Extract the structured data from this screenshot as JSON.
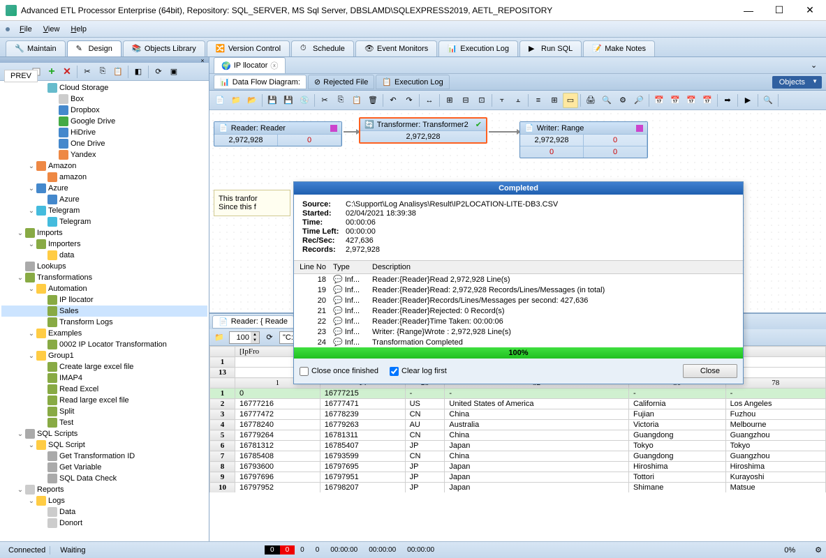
{
  "titlebar": {
    "title": "Advanced ETL Processor Enterprise (64bit), Repository: SQL_SERVER, MS Sql Server, DBSLAMD\\SQLEXPRESS2019, AETL_REPOSITORY"
  },
  "menubar": [
    "File",
    "View",
    "Help"
  ],
  "maintabs": [
    "Maintain",
    "Design",
    "Objects Library",
    "Version Control",
    "Schedule",
    "Event Monitors",
    "Execution Log",
    "Run SQL",
    "Make Notes"
  ],
  "maintabs_active": 1,
  "prev_btn": "PREV",
  "tree": [
    {
      "d": 3,
      "exp": "",
      "icon": "#6bc",
      "label": "Cloud Storage"
    },
    {
      "d": 4,
      "exp": "",
      "icon": "#ccc",
      "label": "Box"
    },
    {
      "d": 4,
      "exp": "",
      "icon": "#48c",
      "label": "Dropbox"
    },
    {
      "d": 4,
      "exp": "",
      "icon": "#4a4",
      "label": "Google Drive"
    },
    {
      "d": 4,
      "exp": "",
      "icon": "#48c",
      "label": "HiDrive"
    },
    {
      "d": 4,
      "exp": "",
      "icon": "#48c",
      "label": "One Drive"
    },
    {
      "d": 4,
      "exp": "",
      "icon": "#e84",
      "label": "Yandex"
    },
    {
      "d": 2,
      "exp": "v",
      "icon": "#e84",
      "label": "Amazon"
    },
    {
      "d": 3,
      "exp": "",
      "icon": "#e84",
      "label": "amazon"
    },
    {
      "d": 2,
      "exp": "v",
      "icon": "#48c",
      "label": "Azure"
    },
    {
      "d": 3,
      "exp": "",
      "icon": "#48c",
      "label": "Azure"
    },
    {
      "d": 2,
      "exp": "v",
      "icon": "#4bd",
      "label": "Telegram"
    },
    {
      "d": 3,
      "exp": "",
      "icon": "#4bd",
      "label": "Telegram"
    },
    {
      "d": 1,
      "exp": "v",
      "icon": "#8a4",
      "label": "Imports"
    },
    {
      "d": 2,
      "exp": "v",
      "icon": "#8a4",
      "label": "Importers"
    },
    {
      "d": 3,
      "exp": "",
      "icon": "#fc4",
      "label": "data"
    },
    {
      "d": 1,
      "exp": "",
      "icon": "#aaa",
      "label": "Lookups"
    },
    {
      "d": 1,
      "exp": "v",
      "icon": "#8a4",
      "label": "Transformations"
    },
    {
      "d": 2,
      "exp": "v",
      "icon": "#fc4",
      "label": "Automation"
    },
    {
      "d": 3,
      "exp": "",
      "icon": "#8a4",
      "label": "IP llocator"
    },
    {
      "d": 3,
      "exp": "",
      "icon": "#8a4",
      "label": "Sales",
      "selected": true
    },
    {
      "d": 3,
      "exp": "",
      "icon": "#8a4",
      "label": "Transform Logs"
    },
    {
      "d": 2,
      "exp": "v",
      "icon": "#fc4",
      "label": "Examples"
    },
    {
      "d": 3,
      "exp": "",
      "icon": "#8a4",
      "label": "0002 IP Locator Transformation"
    },
    {
      "d": 2,
      "exp": "v",
      "icon": "#fc4",
      "label": "Group1"
    },
    {
      "d": 3,
      "exp": "",
      "icon": "#8a4",
      "label": "Create large excel file"
    },
    {
      "d": 3,
      "exp": "",
      "icon": "#8a4",
      "label": "IMAP4"
    },
    {
      "d": 3,
      "exp": "",
      "icon": "#8a4",
      "label": "Read Excel"
    },
    {
      "d": 3,
      "exp": "",
      "icon": "#8a4",
      "label": "Read large excel file"
    },
    {
      "d": 3,
      "exp": "",
      "icon": "#8a4",
      "label": "Split"
    },
    {
      "d": 3,
      "exp": "",
      "icon": "#8a4",
      "label": "Test"
    },
    {
      "d": 1,
      "exp": "v",
      "icon": "#aaa",
      "label": "SQL Scripts"
    },
    {
      "d": 2,
      "exp": "v",
      "icon": "#fc4",
      "label": "SQL Script"
    },
    {
      "d": 3,
      "exp": "",
      "icon": "#aaa",
      "label": "Get Transformation ID"
    },
    {
      "d": 3,
      "exp": "",
      "icon": "#aaa",
      "label": "Get Variable"
    },
    {
      "d": 3,
      "exp": "",
      "icon": "#aaa",
      "label": "SQL Data Check"
    },
    {
      "d": 1,
      "exp": "v",
      "icon": "#ccc",
      "label": "Reports"
    },
    {
      "d": 2,
      "exp": "v",
      "icon": "#fc4",
      "label": "Logs"
    },
    {
      "d": 3,
      "exp": "",
      "icon": "#ccc",
      "label": "Data"
    },
    {
      "d": 3,
      "exp": "",
      "icon": "#ccc",
      "label": "Donort"
    }
  ],
  "doc_tab": {
    "label": "IP llocator"
  },
  "subtabs": [
    "Data Flow Diagram:",
    "Rejected File",
    "Execution Log"
  ],
  "subtabs_active": 0,
  "objects_label": "Objects",
  "nodes": {
    "reader": {
      "title": "Reader: Reader",
      "records": "2,972,928",
      "rejected": "0"
    },
    "transformer": {
      "title": "Transformer: Transformer2",
      "records": "2,972,928"
    },
    "writer": {
      "title": "Writer: Range",
      "records": "2,972,928",
      "rejected": "0",
      "r2a": "0",
      "r2b": "0"
    }
  },
  "note": {
    "l1": "This tranfor",
    "l2": "Since this f"
  },
  "completed": {
    "title": "Completed",
    "info": [
      {
        "k": "Source:",
        "v": "C:\\Support\\Log Analisys\\Result\\IP2LOCATION-LITE-DB3.CSV"
      },
      {
        "k": "Started:",
        "v": "02/04/2021 18:39:38"
      },
      {
        "k": "Time:",
        "v": "00:00:06"
      },
      {
        "k": "Time Left:",
        "v": "00:00:00"
      },
      {
        "k": "Rec/Sec:",
        "v": "427,636"
      },
      {
        "k": "Records:",
        "v": "2,972,928"
      }
    ],
    "log_headers": [
      "Line No",
      "Type",
      "Description"
    ],
    "log": [
      {
        "n": "18",
        "t": "Inf...",
        "d": "Reader:{Reader}Read 2,972,928 Line(s)"
      },
      {
        "n": "19",
        "t": "Inf...",
        "d": "Reader:{Reader}Read: 2,972,928 Records/Lines/Messages (in total)"
      },
      {
        "n": "20",
        "t": "Inf...",
        "d": "Reader:{Reader}Records/Lines/Messages per second: 427,636"
      },
      {
        "n": "21",
        "t": "Inf...",
        "d": "Reader:{Reader}Rejected: 0 Record(s)"
      },
      {
        "n": "22",
        "t": "Inf...",
        "d": "Reader:{Reader}Time Taken: 00:00:06"
      },
      {
        "n": "23",
        "t": "Inf...",
        "d": "Writer: {Range}Wrote : 2,972,928 Line(s)"
      },
      {
        "n": "24",
        "t": "Inf...",
        "d": "Transformation Completed"
      }
    ],
    "progress": "100%",
    "close_once": "Close once finished",
    "clear_log": "Clear log first",
    "close_btn": "Close"
  },
  "reader_panel": {
    "tab": "Reader: { Reade",
    "lines": "100",
    "path": "\"C:\\Sup",
    "col_header_row1": [
      "",
      "[IpFro"
    ],
    "row_nums_left": [
      "1",
      "13"
    ],
    "col_headers": [
      "",
      "1",
      "14",
      "28",
      "32",
      "30",
      "78"
    ],
    "rows": [
      {
        "n": "1",
        "c": [
          "0",
          "16777215",
          "-",
          "-",
          "-",
          "-"
        ],
        "hl": true
      },
      {
        "n": "2",
        "c": [
          "16777216",
          "16777471",
          "US",
          "United States of America",
          "California",
          "Los Angeles"
        ]
      },
      {
        "n": "3",
        "c": [
          "16777472",
          "16778239",
          "CN",
          "China",
          "Fujian",
          "Fuzhou"
        ]
      },
      {
        "n": "4",
        "c": [
          "16778240",
          "16779263",
          "AU",
          "Australia",
          "Victoria",
          "Melbourne"
        ]
      },
      {
        "n": "5",
        "c": [
          "16779264",
          "16781311",
          "CN",
          "China",
          "Guangdong",
          "Guangzhou"
        ]
      },
      {
        "n": "6",
        "c": [
          "16781312",
          "16785407",
          "JP",
          "Japan",
          "Tokyo",
          "Tokyo"
        ]
      },
      {
        "n": "7",
        "c": [
          "16785408",
          "16793599",
          "CN",
          "China",
          "Guangdong",
          "Guangzhou"
        ]
      },
      {
        "n": "8",
        "c": [
          "16793600",
          "16797695",
          "JP",
          "Japan",
          "Hiroshima",
          "Hiroshima"
        ]
      },
      {
        "n": "9",
        "c": [
          "16797696",
          "16797951",
          "JP",
          "Japan",
          "Tottori",
          "Kurayoshi"
        ]
      },
      {
        "n": "10",
        "c": [
          "16797952",
          "16798207",
          "JP",
          "Japan",
          "Shimane",
          "Matsue"
        ]
      }
    ]
  },
  "statusbar": {
    "connected": "Connected",
    "waiting": "Waiting",
    "segs": [
      "0",
      "0",
      "0",
      "0",
      "00:00:00",
      "00:00:00",
      "00:00:00"
    ],
    "pct": "0%"
  }
}
